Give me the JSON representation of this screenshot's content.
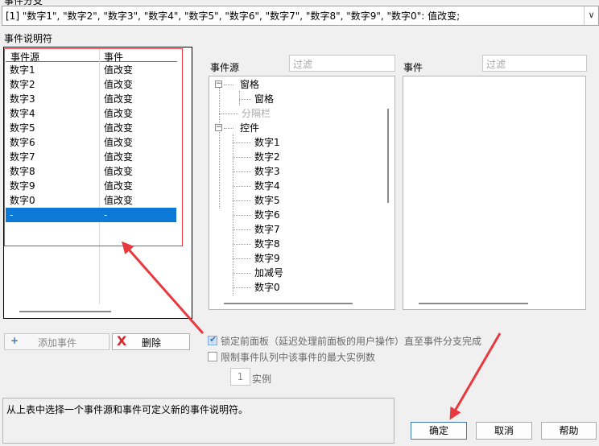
{
  "top_cut_label": "事件分支",
  "case_selector": {
    "value": "[1] \"数字1\", \"数字2\", \"数字3\", \"数字4\", \"数字5\", \"数字6\", \"数字7\", \"数字8\", \"数字9\", \"数字0\": 值改变;"
  },
  "specifiers": {
    "label": "事件说明符",
    "col_source": "事件源",
    "col_event": "事件",
    "rows": [
      {
        "source": "数字1",
        "event": "值改变"
      },
      {
        "source": "数字2",
        "event": "值改变"
      },
      {
        "source": "数字3",
        "event": "值改变"
      },
      {
        "source": "数字4",
        "event": "值改变"
      },
      {
        "source": "数字5",
        "event": "值改变"
      },
      {
        "source": "数字6",
        "event": "值改变"
      },
      {
        "source": "数字7",
        "event": "值改变"
      },
      {
        "source": "数字8",
        "event": "值改变"
      },
      {
        "source": "数字9",
        "event": "值改变"
      },
      {
        "source": "数字0",
        "event": "值改变"
      },
      {
        "source": "-",
        "event": "-"
      }
    ]
  },
  "event_sources": {
    "label": "事件源",
    "filter_placeholder": "过滤",
    "tree": [
      {
        "label": "窗格",
        "toggle": "−"
      },
      {
        "label": "窗格"
      },
      {
        "label": "分隔栏",
        "dim": true
      },
      {
        "label": "控件",
        "toggle": "−"
      },
      {
        "label": "数字1"
      },
      {
        "label": "数字2"
      },
      {
        "label": "数字3"
      },
      {
        "label": "数字4"
      },
      {
        "label": "数字5"
      },
      {
        "label": "数字6"
      },
      {
        "label": "数字7"
      },
      {
        "label": "数字8"
      },
      {
        "label": "数字9"
      },
      {
        "label": "加减号"
      },
      {
        "label": "数字0"
      }
    ]
  },
  "events": {
    "label": "事件",
    "filter_placeholder": "过滤"
  },
  "buttons": {
    "add_event": "添加事件",
    "add_icon": "+",
    "delete": "删除",
    "delete_icon": "X",
    "ok": "确定",
    "cancel": "取消",
    "help": "帮助"
  },
  "options": {
    "lock_panel": "锁定前面板（延迟处理前面板的用户操作）直至事件分支完成",
    "lock_panel_checked": true,
    "limit_queue": "限制事件队列中该事件的最大实例数",
    "limit_queue_checked": false,
    "instances_value": "1",
    "instances_label": "实例"
  },
  "description": "从上表中选择一个事件源和事件可定义新的事件说明符。",
  "colors": {
    "selection": "#0c78d8",
    "annotation_red": "#e8393f"
  }
}
